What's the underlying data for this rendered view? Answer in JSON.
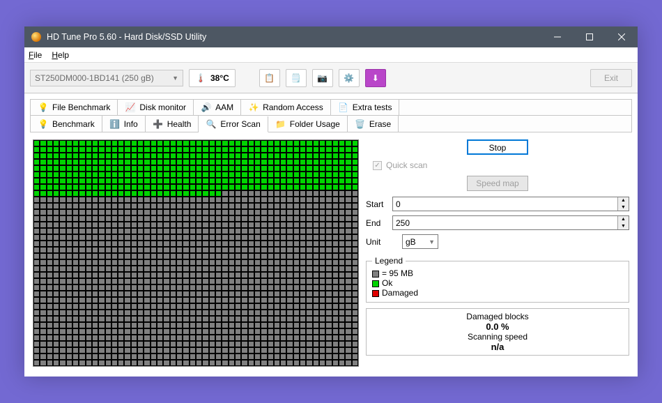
{
  "window": {
    "title": "HD Tune Pro 5.60 - Hard Disk/SSD Utility"
  },
  "menu": {
    "file": "File",
    "help": "Help"
  },
  "toolbar": {
    "drive": "ST250DM000-1BD141 (250 gB)",
    "temperature": "38°C",
    "exit": "Exit"
  },
  "tabs": {
    "row1": [
      "File Benchmark",
      "Disk monitor",
      "AAM",
      "Random Access",
      "Extra tests"
    ],
    "row2": [
      "Benchmark",
      "Info",
      "Health",
      "Error Scan",
      "Folder Usage",
      "Erase"
    ],
    "selected": "Error Scan"
  },
  "scan_grid": {
    "cols": 50,
    "rows": 36,
    "ok_cells": 429
  },
  "side": {
    "stop": "Stop",
    "quick_scan": "Quick scan",
    "speed_map": "Speed map",
    "start_label": "Start",
    "start_value": "0",
    "end_label": "End",
    "end_value": "250",
    "unit_label": "Unit",
    "unit_value": "gB",
    "legend_title": "Legend",
    "legend_block": "= 95 MB",
    "legend_ok": "Ok",
    "legend_dmg": "Damaged",
    "dmg_blocks_label": "Damaged blocks",
    "dmg_blocks_value": "0.0 %",
    "speed_label": "Scanning speed",
    "speed_value": "n/a"
  }
}
